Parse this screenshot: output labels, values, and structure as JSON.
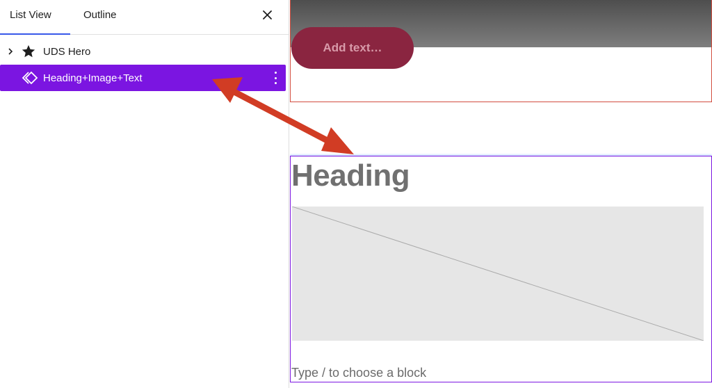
{
  "sidebar": {
    "tabs": [
      {
        "label": "List View",
        "active": true
      },
      {
        "label": "Outline",
        "active": false
      }
    ],
    "close_icon": "close-icon",
    "items": [
      {
        "label": "UDS Hero",
        "icon": "star-icon",
        "expand_icon": "chevron-right-icon"
      },
      {
        "label": "Heading+Image+Text",
        "icon": "group-icon",
        "selected": true,
        "options_icon": "more-vertical-icon"
      }
    ]
  },
  "canvas": {
    "hero": {
      "button_text": "Add text…"
    },
    "group": {
      "heading": "Heading",
      "image_icon": "image-placeholder",
      "placeholder_text": "Type / to choose a block"
    }
  },
  "annotation": {
    "icon": "double-headed-arrow-icon"
  },
  "colors": {
    "accent": "#3858e9",
    "selected_row": "#7b15e1",
    "arrow": "#d13c24",
    "hero_border": "#d24d3f",
    "hero_button": "#8a2540"
  }
}
